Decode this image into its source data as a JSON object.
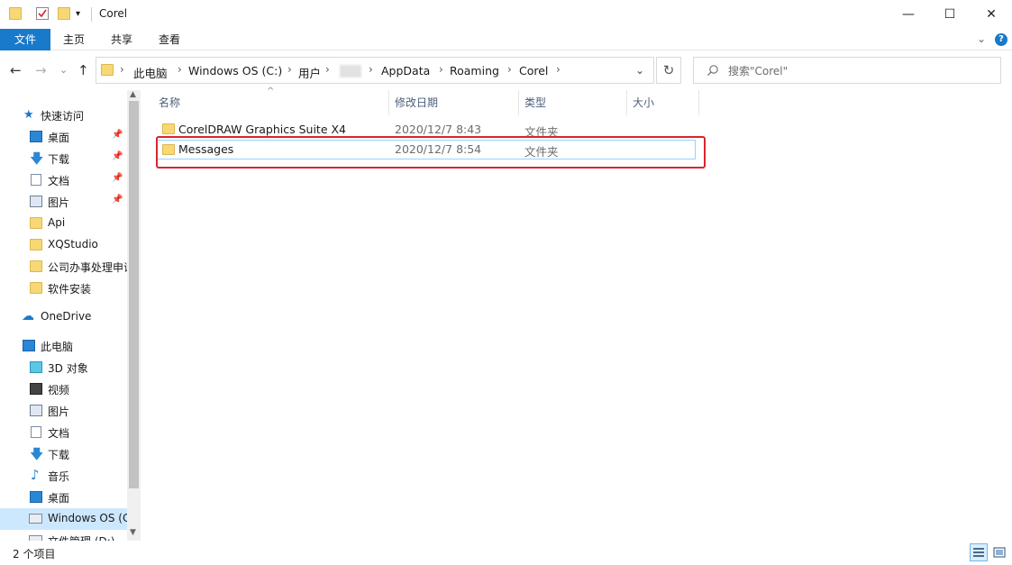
{
  "window": {
    "title": "Corel",
    "buttons": {
      "minimize": "—",
      "maximize": "☐",
      "close": "✕"
    }
  },
  "ribbon": {
    "tabs": [
      "文件",
      "主页",
      "共享",
      "查看"
    ]
  },
  "address": {
    "crumbs": [
      "此电脑",
      "Windows OS (C:)",
      "用户",
      "AppData",
      "Roaming",
      "Corel"
    ]
  },
  "search": {
    "placeholder": "搜索\"Corel\""
  },
  "nav": {
    "quick_access": "快速访问",
    "quick_items": [
      "桌面",
      "下载",
      "文档",
      "图片",
      "Api",
      "XQStudio",
      "公司办事处理申请",
      "软件安装"
    ],
    "onedrive": "OneDrive",
    "this_pc": "此电脑",
    "pc_items": [
      "3D 对象",
      "视频",
      "图片",
      "文档",
      "下载",
      "音乐",
      "桌面",
      "Windows OS (C:)",
      "文件管理 (D:)"
    ]
  },
  "columns": {
    "name": "名称",
    "modified": "修改日期",
    "type": "类型",
    "size": "大小"
  },
  "files": [
    {
      "name": "CorelDRAW Graphics Suite X4",
      "modified": "2020/12/7 8:43",
      "type": "文件夹"
    },
    {
      "name": "Messages",
      "modified": "2020/12/7 8:54",
      "type": "文件夹"
    }
  ],
  "status": {
    "count": "2 个项目"
  },
  "colors": {
    "accent": "#1979ca",
    "highlight": "#d8262b",
    "folder": "#f8d775"
  }
}
